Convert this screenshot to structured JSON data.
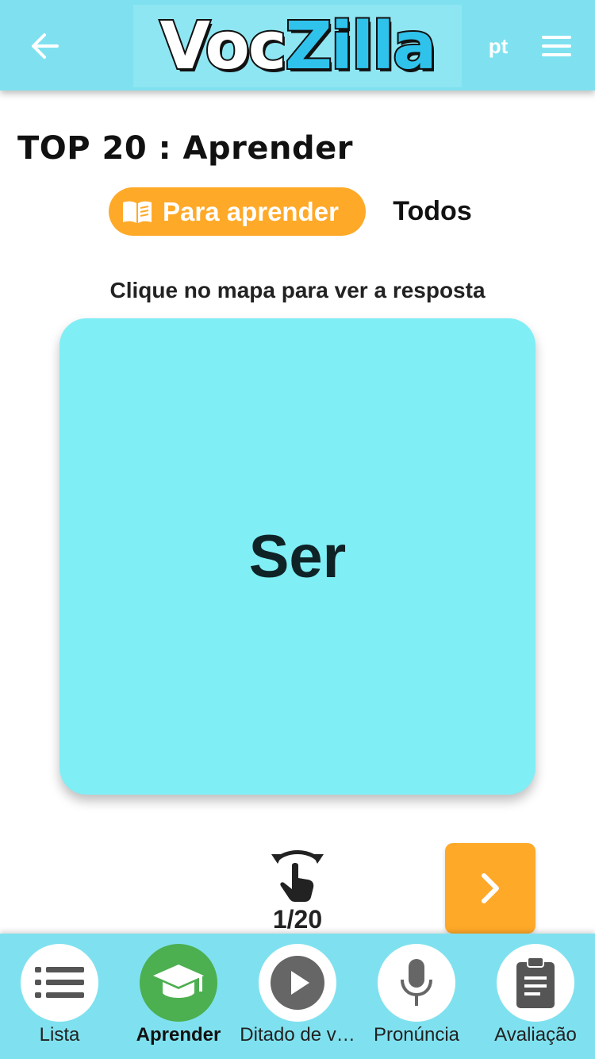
{
  "header": {
    "logo_part1": "Voc",
    "logo_part2": "Zilla",
    "language": "pt",
    "back_icon": "arrow-left-icon",
    "menu_icon": "hamburger-menu-icon"
  },
  "page": {
    "title": "TOP 20 : Aprender"
  },
  "toggle": {
    "active_label": "Para aprender",
    "active_icon": "open-book-icon",
    "inactive_label": "Todos"
  },
  "instruction": "Clique no mapa para ver a resposta",
  "card": {
    "word": "Ser"
  },
  "progress": {
    "counter": "1/20",
    "current": 1,
    "total": 20,
    "flip_icon": "tap-rotate-icon",
    "next_icon": "chevron-right-icon"
  },
  "bottom_nav": {
    "items": [
      {
        "label": "Lista",
        "icon": "list-icon",
        "active": false
      },
      {
        "label": "Aprender",
        "icon": "graduation-cap-icon",
        "active": true
      },
      {
        "label": "Ditado de v…",
        "icon": "play-icon",
        "active": false
      },
      {
        "label": "Pronúncia",
        "icon": "microphone-icon",
        "active": false
      },
      {
        "label": "Avaliação",
        "icon": "clipboard-icon",
        "active": false
      }
    ]
  },
  "colors": {
    "header_bg": "#7fe1ef",
    "accent_orange": "#ffa928",
    "card_bg": "#80eef5",
    "active_green": "#4caf50",
    "icon_gray": "#555555"
  }
}
